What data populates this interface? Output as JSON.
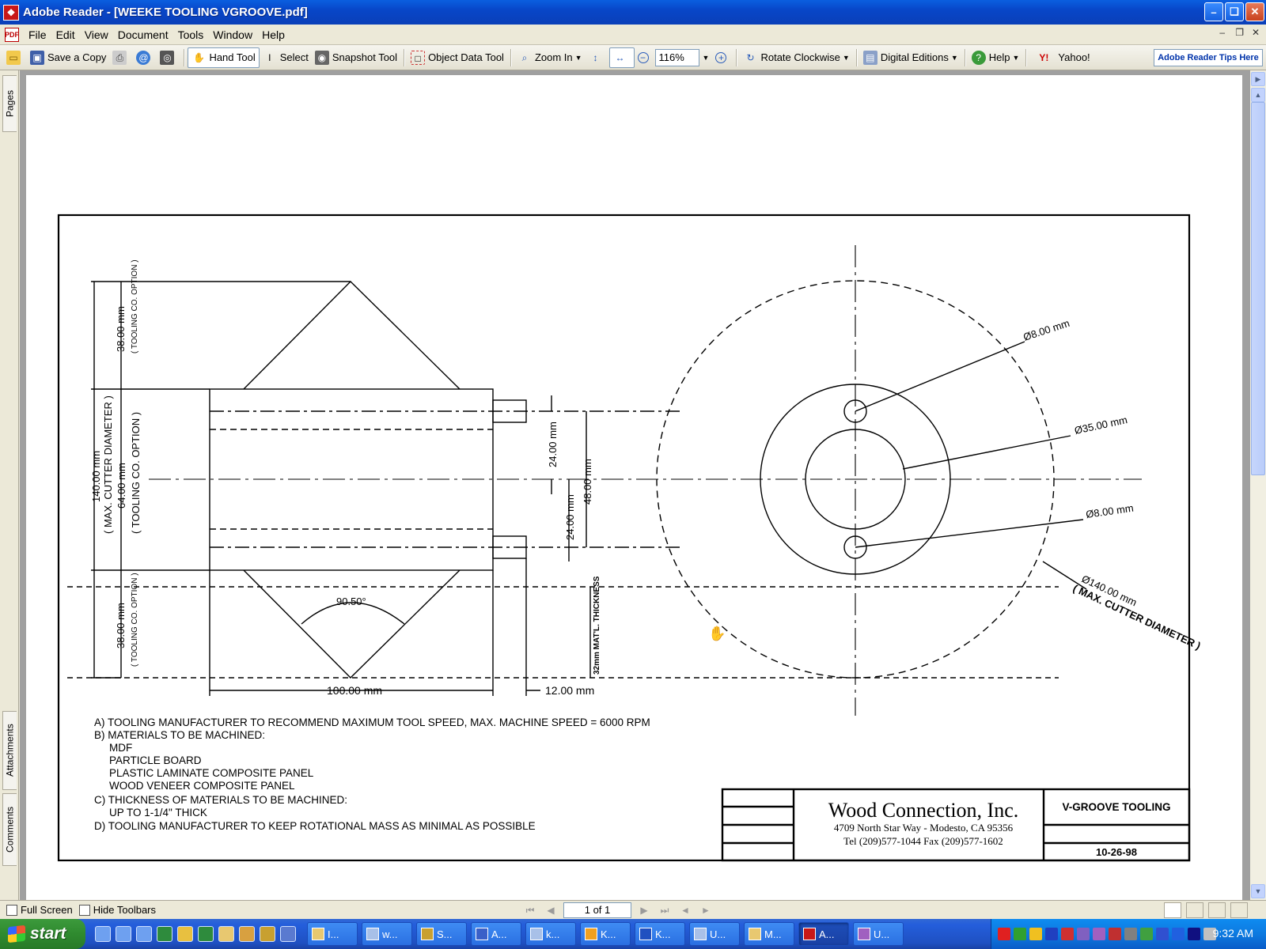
{
  "window": {
    "title": "Adobe Reader - [WEEKE TOOLING VGROOVE.pdf]"
  },
  "menu": [
    "File",
    "Edit",
    "View",
    "Document",
    "Tools",
    "Window",
    "Help"
  ],
  "toolbar": {
    "save_copy": "Save a Copy",
    "hand_tool": "Hand Tool",
    "select": "Select",
    "snapshot": "Snapshot Tool",
    "object_data": "Object Data Tool",
    "zoom_in": "Zoom In",
    "zoom_value": "116%",
    "rotate": "Rotate Clockwise",
    "digital_editions": "Digital Editions",
    "help": "Help",
    "yahoo": "Yahoo!",
    "tips": "Adobe Reader Tips Here"
  },
  "side_tabs": {
    "pages": "Pages",
    "attachments": "Attachments",
    "comments": "Comments"
  },
  "drawing": {
    "dims": {
      "d38_top": "38.00 mm",
      "tooling_top": "( TOOLING CO. OPTION )",
      "d140": "140.00 mm",
      "max_cutter": "( MAX. CUTTER DIAMETER )",
      "d64": "64.00 mm",
      "tooling_mid": "( TOOLING CO. OPTION )",
      "d38_bot": "38.00 mm",
      "tooling_bot": "( TOOLING CO. OPTION )",
      "angle": "90.50°",
      "d100": "100.00 mm",
      "d12": "12.00 mm",
      "d24_a": "24.00 mm",
      "d24_b": "24.00 mm",
      "d48": "48.00 mm",
      "matl": "32mm MAT'L. THICKNESS",
      "hole_top": "Ø8.00 mm",
      "bore": "Ø35.00 mm",
      "hole_bot": "Ø8.00 mm",
      "outer": "Ø140.00 mm",
      "outer_note": "( MAX. CUTTER DIAMETER )"
    },
    "notes": [
      "A)  TOOLING MANUFACTURER TO RECOMMEND MAXIMUM TOOL SPEED, MAX. MACHINE SPEED = 6000 RPM",
      "B)  MATERIALS TO BE MACHINED:",
      "MDF",
      "PARTICLE BOARD",
      "PLASTIC LAMINATE COMPOSITE PANEL",
      "WOOD VENEER COMPOSITE PANEL",
      "C)  THICKNESS OF MATERIALS TO BE MACHINED:",
      "UP TO 1-1/4\" THICK",
      "D)  TOOLING MANUFACTURER TO KEEP ROTATIONAL MASS AS MINIMAL AS POSSIBLE"
    ],
    "title_block": {
      "company": "Wood Connection, Inc.",
      "address": "4709 North Star Way - Modesto, CA 95356",
      "phone": "Tel (209)577-1044 Fax (209)577-1602",
      "title": "V-GROOVE TOOLING",
      "date": "10-26-98"
    }
  },
  "status": {
    "full_screen": "Full Screen",
    "hide_toolbars": "Hide Toolbars",
    "page": "1 of 1"
  },
  "taskbar": {
    "start": "start",
    "tasks": [
      "I...",
      "w...",
      "S...",
      "A...",
      "k...",
      "K...",
      "K...",
      "U...",
      "M...",
      "A...",
      "U..."
    ],
    "clock": "9:32 AM"
  }
}
